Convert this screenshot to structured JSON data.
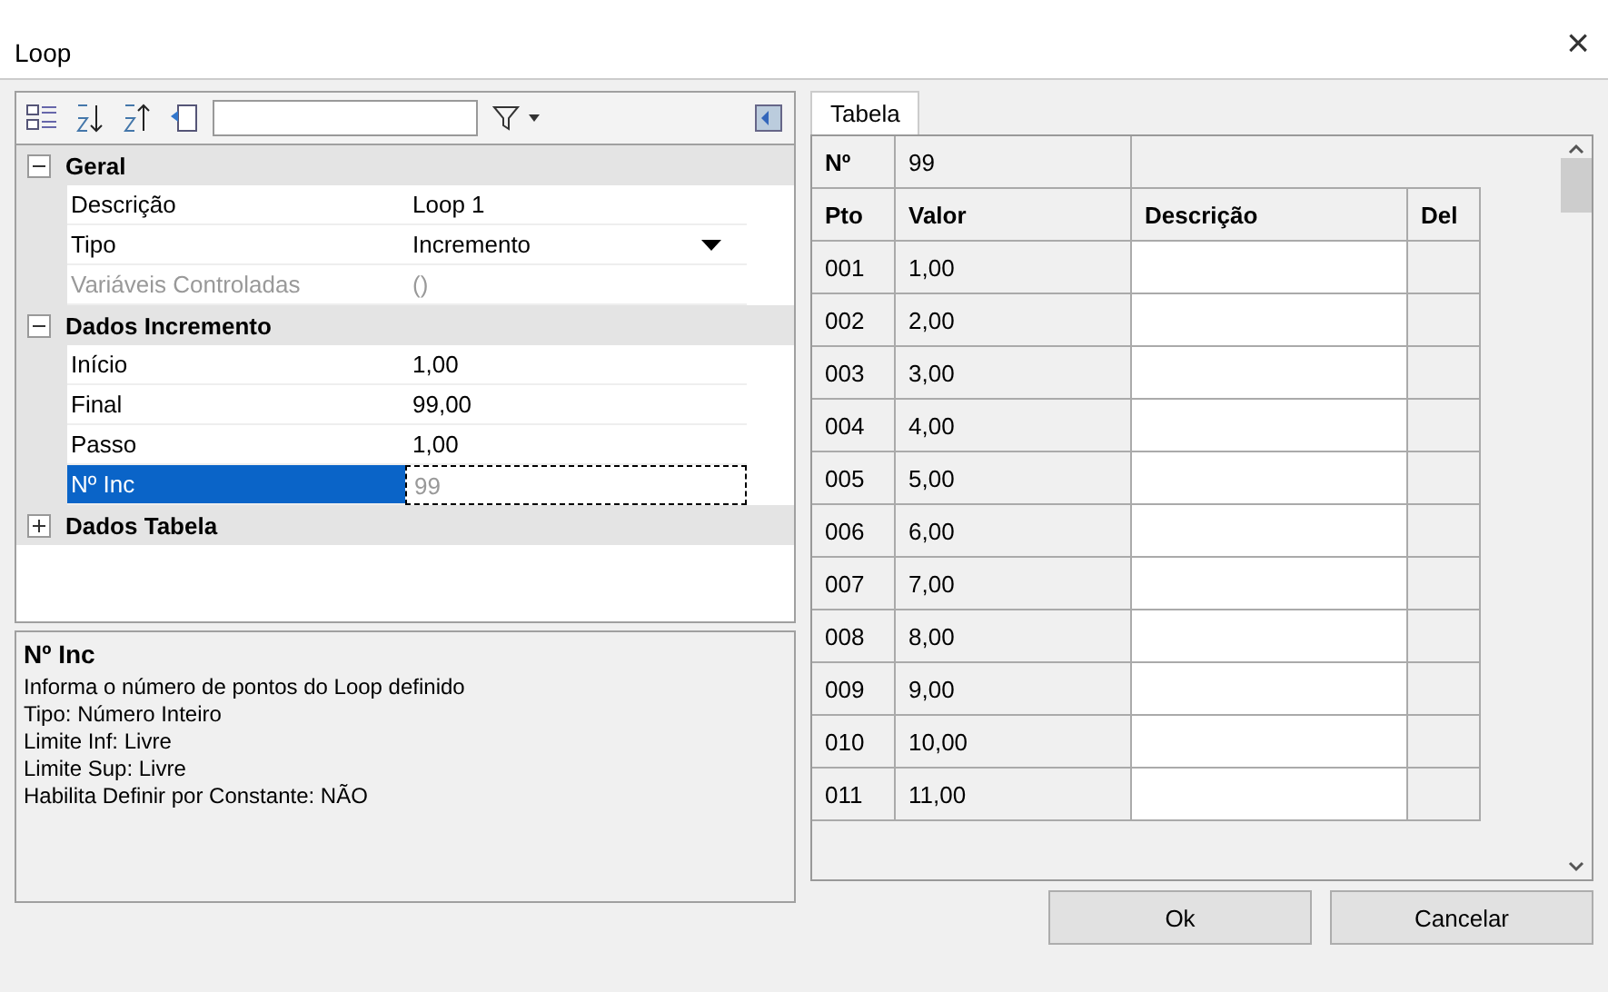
{
  "window": {
    "title": "Loop",
    "close": "×"
  },
  "property_grid": {
    "categories": [
      {
        "name": "Geral",
        "expanded": true,
        "properties": [
          {
            "name": "Descrição",
            "value": "Loop 1",
            "kind": "text",
            "disabled": false,
            "selected": false
          },
          {
            "name": "Tipo",
            "value": "Incremento",
            "kind": "dropdown",
            "disabled": false,
            "selected": false
          },
          {
            "name": "Variáveis Controladas",
            "value": "()",
            "kind": "text",
            "disabled": true,
            "selected": false
          }
        ]
      },
      {
        "name": "Dados Incremento",
        "expanded": true,
        "properties": [
          {
            "name": "Início",
            "value": "1,00",
            "kind": "text",
            "disabled": false,
            "selected": false
          },
          {
            "name": "Final",
            "value": "99,00",
            "kind": "text",
            "disabled": false,
            "selected": false
          },
          {
            "name": "Passo",
            "value": "1,00",
            "kind": "text",
            "disabled": false,
            "selected": false
          },
          {
            "name": "Nº Inc",
            "value": "99",
            "kind": "text",
            "disabled": true,
            "selected": true
          }
        ]
      },
      {
        "name": "Dados Tabela",
        "expanded": false
      }
    ]
  },
  "help": {
    "title": "Nº Inc",
    "lines": [
      "Informa o número de pontos do Loop definido",
      "Tipo: Número Inteiro",
      "Limite Inf: Livre",
      "Limite Sup: Livre",
      "Habilita Definir por Constante: NÃO"
    ]
  },
  "tabs": [
    {
      "label": "Tabela",
      "selected": true
    }
  ],
  "table": {
    "count_label": "Nº",
    "count_value": "99",
    "columns": [
      "Pto",
      "Valor",
      "Descrição",
      "Del"
    ],
    "rows": [
      [
        "001",
        "1,00"
      ],
      [
        "002",
        "2,00"
      ],
      [
        "003",
        "3,00"
      ],
      [
        "004",
        "4,00"
      ],
      [
        "005",
        "5,00"
      ],
      [
        "006",
        "6,00"
      ],
      [
        "007",
        "7,00"
      ],
      [
        "008",
        "8,00"
      ],
      [
        "009",
        "9,00"
      ],
      [
        "010",
        "10,00"
      ],
      [
        "011",
        "11,00"
      ]
    ]
  },
  "buttons": [
    "Ok",
    "Cancelar"
  ]
}
